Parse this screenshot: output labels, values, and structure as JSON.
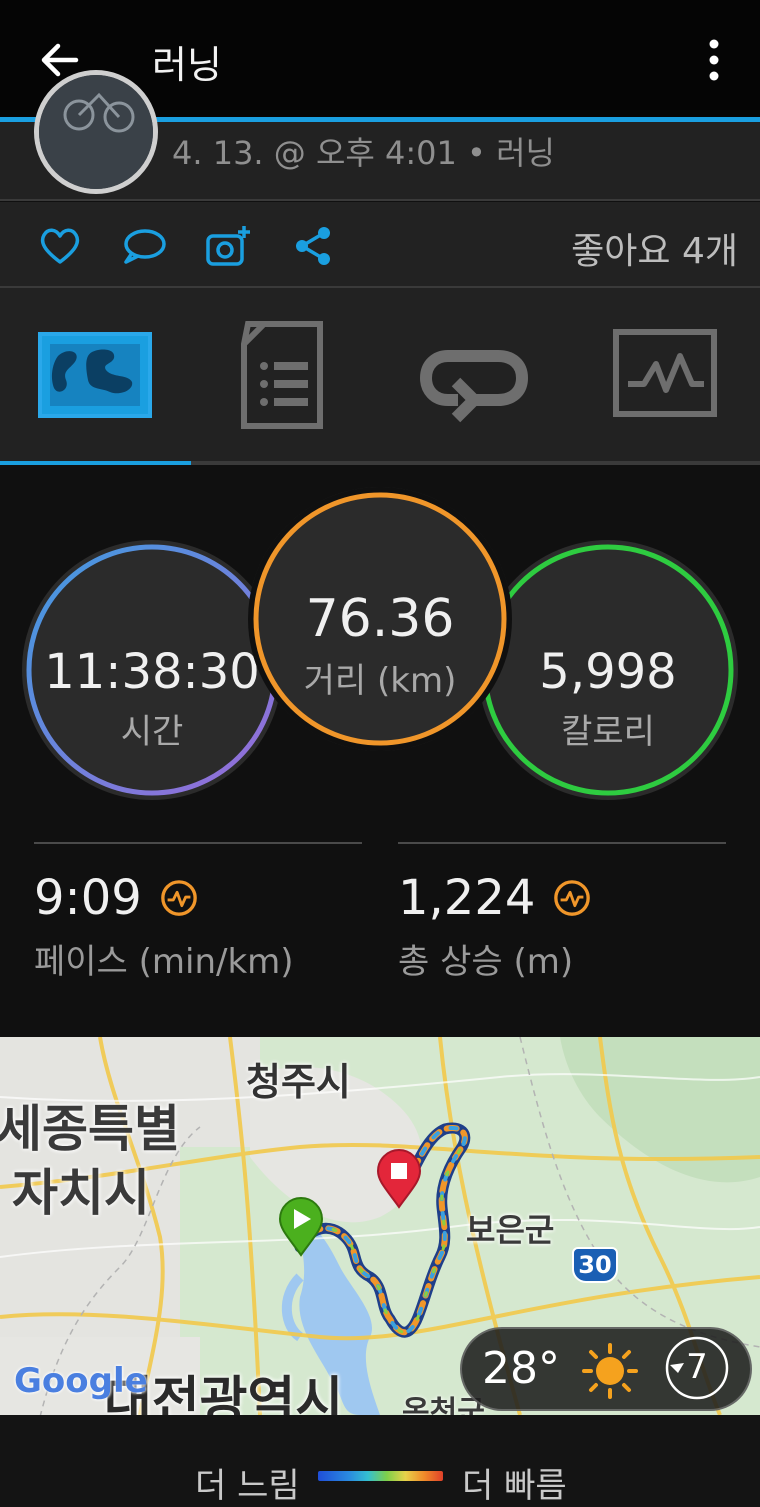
{
  "appbar": {
    "title": "러닝"
  },
  "header": {
    "dateline": "4. 13. @ 오후 4:01 • 러닝"
  },
  "actions": {
    "likes": "좋아요 4개"
  },
  "stats": {
    "time": {
      "value": "11:38:30",
      "label": "시간"
    },
    "distance": {
      "value": "76.36",
      "label": "거리 (km)"
    },
    "calories": {
      "value": "5,998",
      "label": "칼로리"
    },
    "pace": {
      "value": "9:09",
      "label": "페이스 (min/km)"
    },
    "ascent": {
      "value": "1,224",
      "label": "총 상승 (m)"
    }
  },
  "map": {
    "labels": {
      "cheongju": "청주시",
      "sejong1": "세종특별",
      "sejong2": "자치시",
      "boeun": "보은군",
      "daejeon": "대전광역시",
      "okcheon": "옥천군",
      "highway": "30",
      "google": "Google"
    },
    "weather": {
      "temp": "28°",
      "wind": "7"
    }
  },
  "legend": {
    "slow": "더 느림",
    "fast": "더 빠름"
  },
  "colors": {
    "accent": "#1a9fe0",
    "time_ring": "#4a90d9",
    "distance_ring": "#f0962a",
    "calories_ring": "#2ecc40",
    "pulse": "#f0962a"
  },
  "icons": [
    "back-arrow-icon",
    "more-vert-icon",
    "heart-icon",
    "comment-icon",
    "camera-add-icon",
    "share-icon",
    "map-tab-icon",
    "details-tab-icon",
    "laps-tab-icon",
    "charts-tab-icon",
    "pulse-icon",
    "start-pin-icon",
    "end-pin-icon",
    "sun-icon",
    "wind-icon"
  ]
}
